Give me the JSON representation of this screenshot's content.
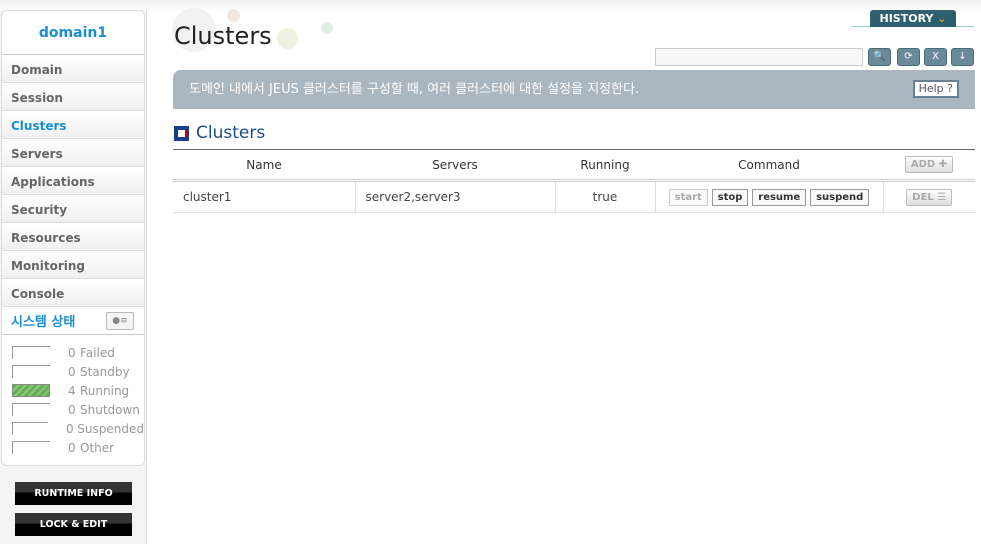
{
  "sidebar": {
    "domain": "domain1",
    "items": [
      {
        "label": "Domain"
      },
      {
        "label": "Session"
      },
      {
        "label": "Clusters"
      },
      {
        "label": "Servers"
      },
      {
        "label": "Applications"
      },
      {
        "label": "Security"
      },
      {
        "label": "Resources"
      },
      {
        "label": "Monitoring"
      },
      {
        "label": "Console"
      }
    ],
    "system_status": {
      "title": "시스템 상태",
      "rows": [
        {
          "count": "0",
          "label": "Failed"
        },
        {
          "count": "0",
          "label": "Standby"
        },
        {
          "count": "4",
          "label": "Running"
        },
        {
          "count": "0",
          "label": "Shutdown"
        },
        {
          "count": "0",
          "label": "Suspended"
        },
        {
          "count": "0",
          "label": "Other"
        }
      ]
    },
    "runtime_info": "RUNTIME INFO",
    "lock_edit": "LOCK & EDIT"
  },
  "header": {
    "title": "Clusters",
    "history": "HISTORY",
    "search_value": ""
  },
  "banner": {
    "text": "도메인 내에서 JEUS 클러스터를 구성할 때, 여러 클러스터에 대한 설정을 지정한다.",
    "help": "Help ?"
  },
  "section": {
    "title": "Clusters"
  },
  "table": {
    "headers": [
      "Name",
      "Servers",
      "Running",
      "Command"
    ],
    "add": "ADD",
    "rows": [
      {
        "name": "cluster1",
        "servers": "server2,server3",
        "running": "true",
        "commands": [
          "start",
          "stop",
          "resume",
          "suspend"
        ],
        "del": "DEL"
      }
    ]
  }
}
